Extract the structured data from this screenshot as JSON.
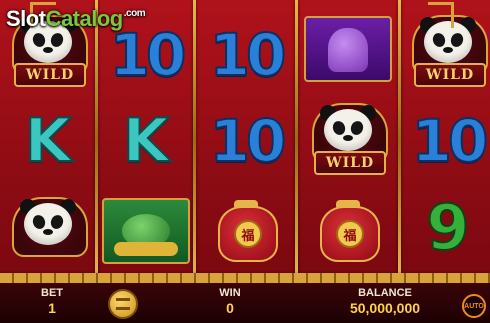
{
  "logo": {
    "prefix": "Slot",
    "accent": "Catalog",
    "tld": ".com"
  },
  "reels": {
    "columns": [
      [
        "wild-panda",
        "k",
        "panda"
      ],
      [
        "10",
        "k",
        "gold-toad"
      ],
      [
        "10",
        "10",
        "red-coin-bag"
      ],
      [
        "purple-lion",
        "wild-panda",
        "red-coin-bag"
      ],
      [
        "wild-panda",
        "10",
        "9"
      ]
    ],
    "wild_label": "WILD",
    "ten_text": "10",
    "k_text": "K",
    "nine_text": "9",
    "bag_glyph": "福"
  },
  "hud": {
    "bet_label": "BET",
    "bet_value": "1",
    "win_label": "WIN",
    "win_value": "0",
    "balance_label": "BALANCE",
    "balance_value": "50,000,000",
    "auto_label": "AUTO"
  },
  "colors": {
    "background": "#a8101a",
    "gold": "#d8a33a",
    "value": "#ffd24a"
  }
}
